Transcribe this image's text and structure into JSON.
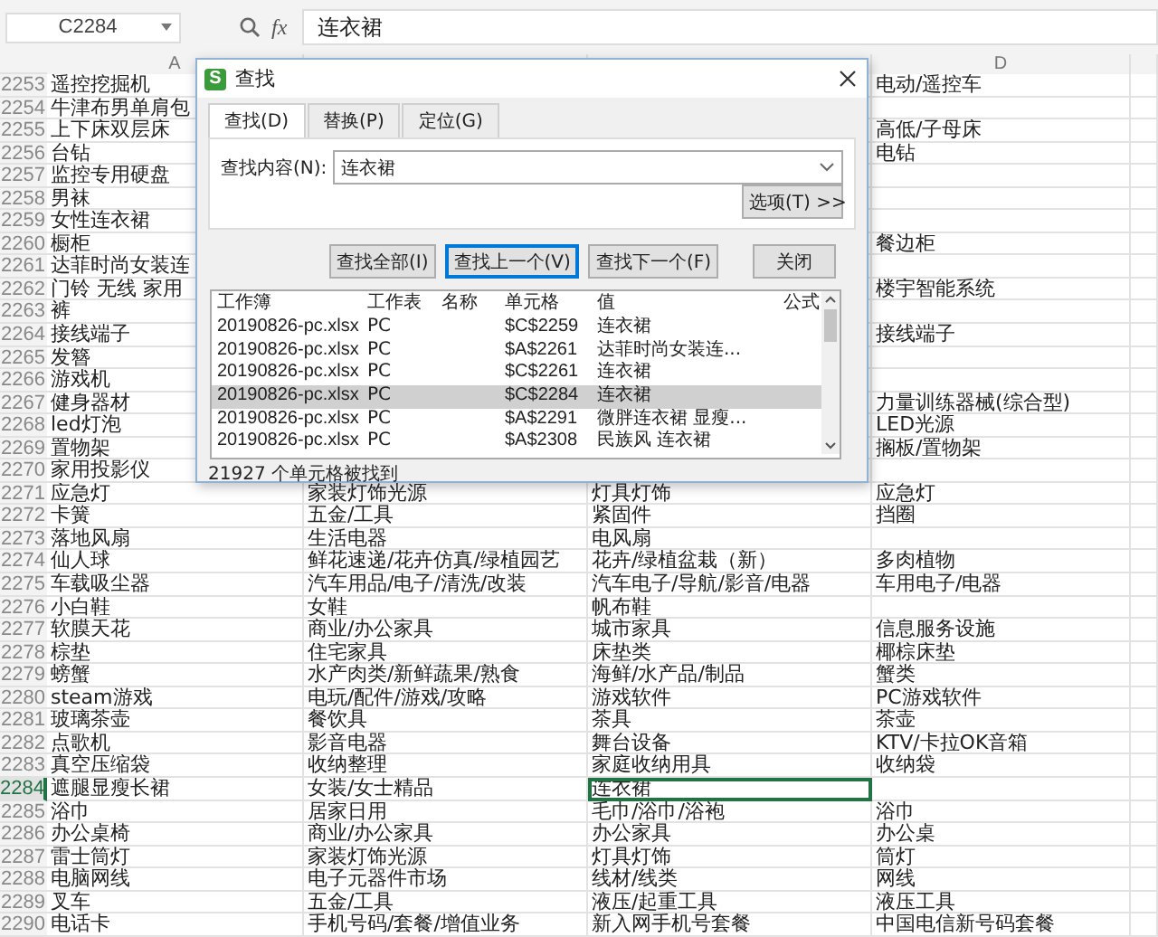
{
  "formula_bar": {
    "name_box": "C2284",
    "fx": "fx",
    "value": "连衣裙"
  },
  "column_headers": {
    "column_a": "A",
    "column_d": "D"
  },
  "rows": [
    {
      "number": "2253",
      "selected": false,
      "cells": [
        "遥控挖掘机",
        null,
        null,
        "电动/遥控车"
      ]
    },
    {
      "number": "2254",
      "selected": false,
      "cells": [
        "牛津布男单肩包",
        null,
        null,
        null
      ]
    },
    {
      "number": "2255",
      "selected": false,
      "cells": [
        "上下床双层床",
        null,
        null,
        "高低/子母床"
      ]
    },
    {
      "number": "2256",
      "selected": false,
      "cells": [
        "台钻",
        null,
        null,
        "电钻"
      ]
    },
    {
      "number": "2257",
      "selected": false,
      "cells": [
        "监控专用硬盘",
        null,
        null,
        null
      ]
    },
    {
      "number": "2258",
      "selected": false,
      "cells": [
        "男袜",
        null,
        null,
        null
      ]
    },
    {
      "number": "2259",
      "selected": false,
      "cells": [
        "女性连衣裙",
        null,
        null,
        null
      ]
    },
    {
      "number": "2260",
      "selected": false,
      "cells": [
        "橱柜",
        null,
        null,
        "餐边柜"
      ]
    },
    {
      "number": "2261",
      "selected": false,
      "cells": [
        "达菲时尚女装连",
        null,
        null,
        null
      ]
    },
    {
      "number": "2262",
      "selected": false,
      "cells": [
        "门铃 无线 家用",
        null,
        null,
        "楼宇智能系统"
      ]
    },
    {
      "number": "2263",
      "selected": false,
      "cells": [
        "裤",
        null,
        null,
        null
      ]
    },
    {
      "number": "2264",
      "selected": false,
      "cells": [
        "接线端子",
        null,
        null,
        "接线端子"
      ]
    },
    {
      "number": "2265",
      "selected": false,
      "cells": [
        "发簪",
        null,
        null,
        null
      ]
    },
    {
      "number": "2266",
      "selected": false,
      "cells": [
        "游戏机",
        null,
        null,
        null
      ]
    },
    {
      "number": "2267",
      "selected": false,
      "cells": [
        "健身器材",
        null,
        null,
        "力量训练器械(综合型)"
      ]
    },
    {
      "number": "2268",
      "selected": false,
      "cells": [
        "led灯泡",
        null,
        null,
        "LED光源"
      ]
    },
    {
      "number": "2269",
      "selected": false,
      "cells": [
        "置物架",
        null,
        null,
        "搁板/置物架"
      ]
    },
    {
      "number": "2270",
      "selected": false,
      "cells": [
        "家用投影仪",
        null,
        null,
        null
      ]
    },
    {
      "number": "2271",
      "selected": false,
      "cells": [
        "应急灯",
        "家装灯饰光源",
        "灯具灯饰",
        "应急灯"
      ]
    },
    {
      "number": "2272",
      "selected": false,
      "cells": [
        "卡簧",
        "五金/工具",
        "紧固件",
        "挡圈"
      ]
    },
    {
      "number": "2273",
      "selected": false,
      "cells": [
        "落地风扇",
        "生活电器",
        "电风扇",
        null
      ]
    },
    {
      "number": "2274",
      "selected": false,
      "cells": [
        "仙人球",
        "鲜花速递/花卉仿真/绿植园艺",
        "花卉/绿植盆栽（新）",
        "多肉植物"
      ]
    },
    {
      "number": "2275",
      "selected": false,
      "cells": [
        "车载吸尘器",
        "汽车用品/电子/清洗/改装",
        "汽车电子/导航/影音/电器",
        "车用电子/电器"
      ]
    },
    {
      "number": "2276",
      "selected": false,
      "cells": [
        "小白鞋",
        "女鞋",
        "帆布鞋",
        null
      ]
    },
    {
      "number": "2277",
      "selected": false,
      "cells": [
        "软膜天花",
        "商业/办公家具",
        "城市家具",
        "信息服务设施"
      ]
    },
    {
      "number": "2278",
      "selected": false,
      "cells": [
        "棕垫",
        "住宅家具",
        "床垫类",
        "椰棕床垫"
      ]
    },
    {
      "number": "2279",
      "selected": false,
      "cells": [
        "螃蟹",
        "水产肉类/新鲜蔬果/熟食",
        "海鲜/水产品/制品",
        "蟹类"
      ]
    },
    {
      "number": "2280",
      "selected": false,
      "cells": [
        "steam游戏",
        "电玩/配件/游戏/攻略",
        "游戏软件",
        "PC游戏软件"
      ]
    },
    {
      "number": "2281",
      "selected": false,
      "cells": [
        "玻璃茶壶",
        "餐饮具",
        "茶具",
        "茶壶"
      ]
    },
    {
      "number": "2282",
      "selected": false,
      "cells": [
        "点歌机",
        "影音电器",
        "舞台设备",
        "KTV/卡拉OK音箱"
      ]
    },
    {
      "number": "2283",
      "selected": false,
      "cells": [
        "真空压缩袋",
        "收纳整理",
        "家庭收纳用具",
        "收纳袋"
      ]
    },
    {
      "number": "2284",
      "selected": true,
      "cells": [
        "遮腿显瘦长裙",
        "女装/女士精品",
        {
          "text": "连衣裙",
          "selected": true
        },
        null
      ]
    },
    {
      "number": "2285",
      "selected": false,
      "cells": [
        "浴巾",
        "居家日用",
        "毛巾/浴巾/浴袍",
        "浴巾"
      ]
    },
    {
      "number": "2286",
      "selected": false,
      "cells": [
        "办公桌椅",
        "商业/办公家具",
        "办公家具",
        "办公桌"
      ]
    },
    {
      "number": "2287",
      "selected": false,
      "cells": [
        "雷士筒灯",
        "家装灯饰光源",
        "灯具灯饰",
        "筒灯"
      ]
    },
    {
      "number": "2288",
      "selected": false,
      "cells": [
        "电脑网线",
        "电子元器件市场",
        "线材/线类",
        "网线"
      ]
    },
    {
      "number": "2289",
      "selected": false,
      "cells": [
        "叉车",
        "五金/工具",
        "液压/起重工具",
        "液压工具"
      ]
    },
    {
      "number": "2290",
      "selected": false,
      "cells": [
        "电话卡",
        "手机号码/套餐/增值业务",
        "新入网手机号套餐",
        "中国电信新号码套餐"
      ]
    }
  ],
  "find_dialog": {
    "icon_letter": "S",
    "title": "查找",
    "tabs": [
      {
        "label": "查找(D)",
        "selected": true
      },
      {
        "label": "替换(P)",
        "selected": false
      },
      {
        "label": "定位(G)",
        "selected": false
      }
    ],
    "find_label": "查找内容(N):",
    "find_value": "连衣裙",
    "options_button": "选项(T) >>",
    "buttons": [
      {
        "label": "查找全部(I)",
        "focused": false
      },
      {
        "label": "查找上一个(V)",
        "focused": true
      },
      {
        "label": "查找下一个(F)",
        "focused": false
      },
      {
        "label": "关闭",
        "focused": false
      }
    ],
    "results": {
      "columns": [
        "工作簿",
        "工作表",
        "名称",
        "单元格",
        "值",
        "公式"
      ],
      "rows": [
        {
          "selected": false,
          "cells": [
            "20190826-pc.xlsx",
            "PC",
            null,
            "$C$2259",
            "连衣裙",
            null
          ]
        },
        {
          "selected": false,
          "cells": [
            "20190826-pc.xlsx",
            "PC",
            null,
            "$A$2261",
            "达菲时尚女装连...",
            null
          ]
        },
        {
          "selected": false,
          "cells": [
            "20190826-pc.xlsx",
            "PC",
            null,
            "$C$2261",
            "连衣裙",
            null
          ]
        },
        {
          "selected": true,
          "cells": [
            "20190826-pc.xlsx",
            "PC",
            null,
            "$C$2284",
            "连衣裙",
            null
          ]
        },
        {
          "selected": false,
          "cells": [
            "20190826-pc.xlsx",
            "PC",
            null,
            "$A$2291",
            "微胖连衣裙 显瘦...",
            null
          ]
        },
        {
          "selected": false,
          "cells": [
            "20190826-pc.xlsx",
            "PC",
            null,
            "$A$2308",
            "民族风 连衣裙",
            null
          ]
        }
      ]
    },
    "status": "21927 个单元格被找到"
  }
}
